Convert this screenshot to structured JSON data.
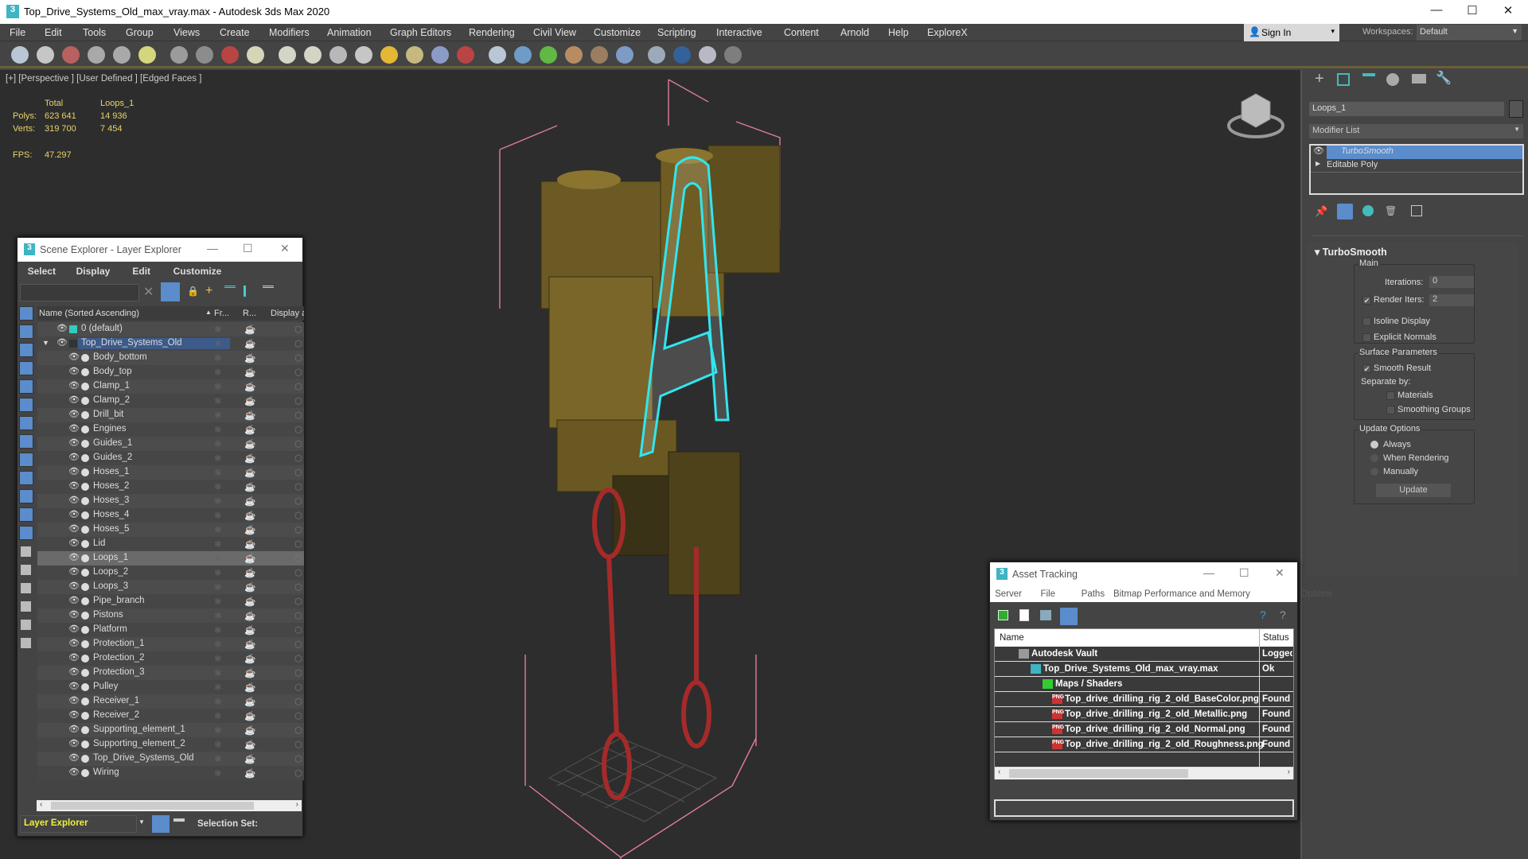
{
  "window": {
    "title": "Top_Drive_Systems_Old_max_vray.max - Autodesk 3ds Max 2020",
    "app_icon": "3",
    "controls": {
      "minimize": "—",
      "maximize": "☐",
      "close": "✕"
    }
  },
  "menu": [
    "File",
    "Edit",
    "Tools",
    "Group",
    "Views",
    "Create",
    "Modifiers",
    "Animation",
    "Graph Editors",
    "Rendering",
    "Civil View",
    "Customize",
    "Scripting",
    "Interactive",
    "Content",
    "Arnold",
    "Help",
    "ExploreX"
  ],
  "signin": {
    "label": "Sign In",
    "arrow": "▾"
  },
  "workspaces": {
    "label": "Workspaces:",
    "value": "Default"
  },
  "toolbar_icons": [
    "teapot-icon",
    "cloud-icon",
    "render-frame-icon",
    "scene-list-icon",
    "table-icon",
    "light-lister-icon",
    "camera-icon",
    "sphere-half-icon",
    "video-camera-icon",
    "plane-icon",
    "dome-icon",
    "ring-light-icon",
    "teapot-wire-icon",
    "cone-icon",
    "sun-icon",
    "sphere-light-icon",
    "particles-icon",
    "atom-icon",
    "rig-icon",
    "gear-flower-icon",
    "grass-icon",
    "hair-hf-icon",
    "fur-icon",
    "material-sphere-icon",
    "image-sample-icon",
    "camera-red-icon",
    "asset-icon",
    "help-icon"
  ],
  "viewport": {
    "label": "[+] [Perspective ] [User Defined ] [Edged Faces ]",
    "stats": {
      "col_total": "Total",
      "col_sel": "Loops_1",
      "polys_label": "Polys:",
      "polys_total": "623 641",
      "polys_sel": "14 936",
      "verts_label": "Verts:",
      "verts_total": "319 700",
      "verts_sel": "7 454",
      "fps_label": "FPS:",
      "fps": "47.297"
    }
  },
  "command_panel": {
    "object_name": "Loops_1",
    "modifier_list": "Modifier List",
    "stack": [
      "TurboSmooth",
      "Editable Poly"
    ],
    "rollout": "TurboSmooth",
    "main": {
      "title": "Main",
      "iterations_label": "Iterations:",
      "iterations": "0",
      "render_iters_label": "Render Iters:",
      "render_iters": "2",
      "isoline": "Isoline Display",
      "explicit": "Explicit Normals"
    },
    "surface": {
      "title": "Surface Parameters",
      "smooth": "Smooth Result",
      "separate": "Separate by:",
      "materials": "Materials",
      "smoothing": "Smoothing Groups"
    },
    "update": {
      "title": "Update Options",
      "always": "Always",
      "when": "When Rendering",
      "manually": "Manually",
      "button": "Update"
    }
  },
  "scene_explorer": {
    "title": "Scene Explorer - Layer Explorer",
    "menu": [
      "Select",
      "Display",
      "Edit",
      "Customize"
    ],
    "columns": [
      "Name (Sorted Ascending)",
      "Fr...",
      "R...",
      "Display as Bo"
    ],
    "layers": [
      "0 (default)",
      "Top_Drive_Systems_Old"
    ],
    "objects": [
      "Body_bottom",
      "Body_top",
      "Clamp_1",
      "Clamp_2",
      "Drill_bit",
      "Engines",
      "Guides_1",
      "Guides_2",
      "Hoses_1",
      "Hoses_2",
      "Hoses_3",
      "Hoses_4",
      "Hoses_5",
      "Lid",
      "Loops_1",
      "Loops_2",
      "Loops_3",
      "Pipe_branch",
      "Pistons",
      "Platform",
      "Protection_1",
      "Protection_2",
      "Protection_3",
      "Pulley",
      "Receiver_1",
      "Receiver_2",
      "Supporting_element_1",
      "Supporting_element_2",
      "Top_Drive_Systems_Old",
      "Wiring"
    ],
    "selected": "Loops_1",
    "explorer_type": "Layer Explorer",
    "selection_set": "Selection Set:"
  },
  "asset_tracking": {
    "title": "Asset Tracking",
    "menu": [
      "Server",
      "File",
      "Paths",
      "Bitmap Performance and Memory",
      "Options"
    ],
    "columns": [
      "Name",
      "Status"
    ],
    "rows": [
      {
        "name": "Autodesk Vault",
        "status": "Logged O",
        "level": 0,
        "icon": "vault-icon"
      },
      {
        "name": "Top_Drive_Systems_Old_max_vray.max",
        "status": "Ok",
        "level": 1,
        "icon": "max-file-icon"
      },
      {
        "name": "Maps / Shaders",
        "status": "",
        "level": 2,
        "icon": "maps-icon"
      },
      {
        "name": "Top_drive_drilling_rig_2_old_BaseColor.png",
        "status": "Found",
        "level": 3,
        "icon": "png-icon"
      },
      {
        "name": "Top_drive_drilling_rig_2_old_Metallic.png",
        "status": "Found",
        "level": 3,
        "icon": "png-icon"
      },
      {
        "name": "Top_drive_drilling_rig_2_old_Normal.png",
        "status": "Found",
        "level": 3,
        "icon": "png-icon"
      },
      {
        "name": "Top_drive_drilling_rig_2_old_Roughness.png",
        "status": "Found",
        "level": 3,
        "icon": "png-icon"
      }
    ]
  }
}
